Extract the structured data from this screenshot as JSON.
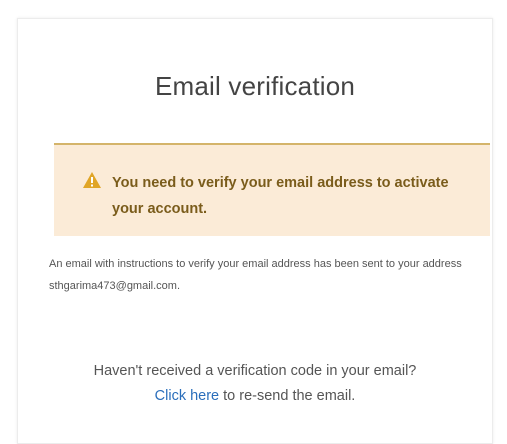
{
  "page": {
    "title": "Email verification"
  },
  "alert": {
    "icon": "warning-icon",
    "message": "You need to verify your email address to activate your account.",
    "colors": {
      "background": "#fbebd7",
      "border": "#d4b46a",
      "text": "#7a5c1b",
      "icon": "#e0a526"
    }
  },
  "info": {
    "message": "An email with instructions to verify your email address has been sent to your address sthgarima473@gmail.com."
  },
  "resend": {
    "question": "Haven't received a verification code in your email?",
    "link_label": "Click here",
    "suffix": " to re-send the email.",
    "link_color": "#2a6ebb"
  }
}
